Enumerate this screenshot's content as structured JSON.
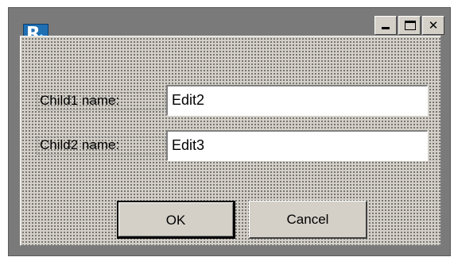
{
  "window": {
    "icon_name": "fastreport-app-icon",
    "controls": {
      "minimize_icon": "minimize-icon",
      "maximize_icon": "maximize-icon",
      "close_label": "✕"
    }
  },
  "form": {
    "child1_label": "Child1 name:",
    "child1_value": "Edit2",
    "child2_label": "Child2 name:",
    "child2_value": "Edit3"
  },
  "buttons": {
    "ok_label": "OK",
    "cancel_label": "Cancel"
  },
  "colors": {
    "frame": "#7a7a7a",
    "face": "#d4d0c8",
    "highlight": "#ffffff",
    "shadow": "#808080",
    "dark_shadow": "#404040",
    "accent": "#1f6fb3"
  }
}
